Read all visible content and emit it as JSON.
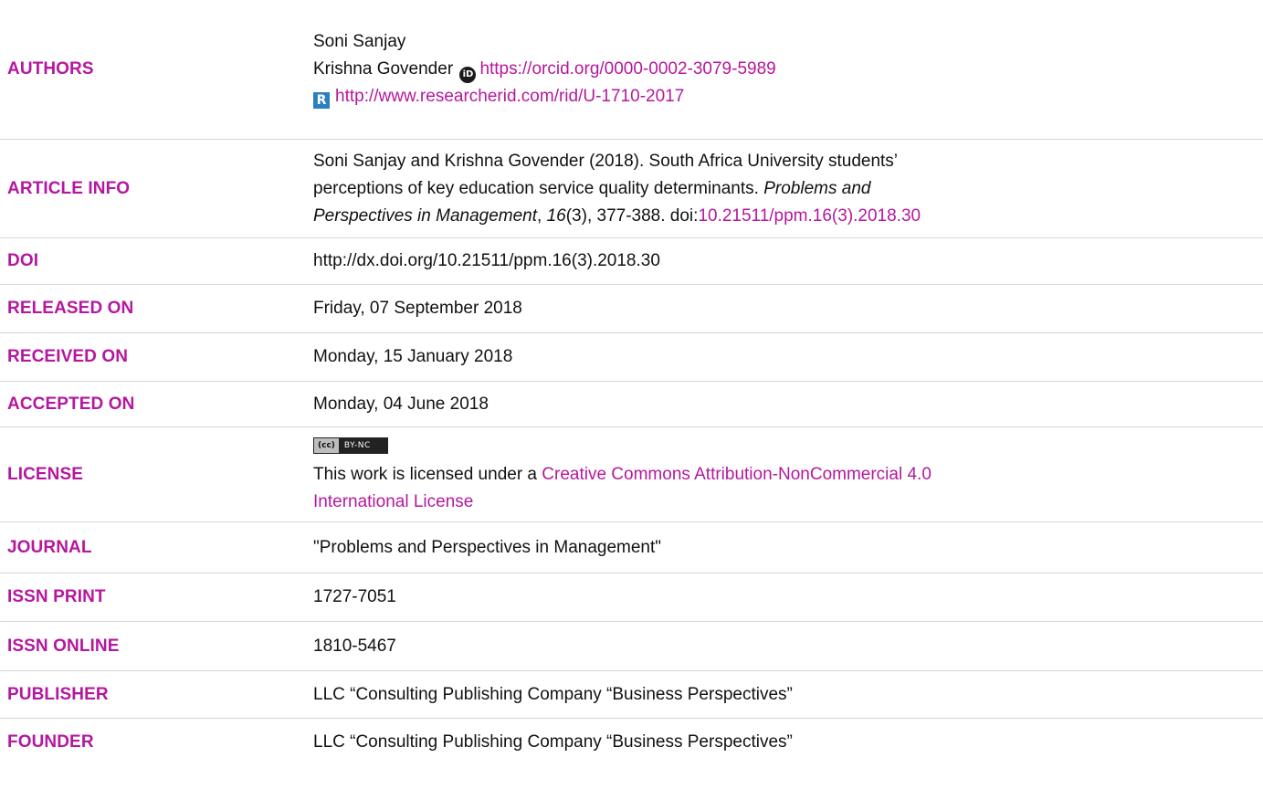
{
  "rows": {
    "authors": {
      "label": "AUTHORS",
      "author1": "Soni Sanjay",
      "author2": "Krishna Govender",
      "orcid_icon_text": "iD",
      "orcid_url": "https://orcid.org/0000-0002-3079-5989",
      "rid_icon_text": "R",
      "rid_url": "http://www.researcherid.com/rid/U-1710-2017"
    },
    "article_info": {
      "label": "ARTICLE INFO",
      "text1": "Soni Sanjay and Krishna Govender (2018). South Africa University students’",
      "text2": "perceptions of key education service quality determinants. ",
      "journal_italic_a": "Problems and",
      "journal_italic_b": "Perspectives in Management",
      "comma": ", ",
      "volume_italic": "16",
      "issue_pages": "(3), 377-388",
      "doi_prefix": ". doi:",
      "doi_link": "10.21511/ppm.16(3).2018.30"
    },
    "doi": {
      "label": "DOI",
      "value": "http://dx.doi.org/10.21511/ppm.16(3).2018.30"
    },
    "released_on": {
      "label": "RELEASED ON",
      "value": "Friday, 07 September 2018"
    },
    "received_on": {
      "label": "RECEIVED ON",
      "value": "Monday, 15 January 2018"
    },
    "accepted_on": {
      "label": "ACCEPTED ON",
      "value": "Monday, 04 June 2018"
    },
    "license": {
      "label": "LICENSE",
      "badge_cc": "(cc)",
      "badge_text": "BY-NC",
      "text_prefix": "This work is licensed under a ",
      "link_line1": "Creative Commons Attribution-NonCommercial 4.0",
      "link_line2": "International License"
    },
    "journal": {
      "label": "JOURNAL",
      "value": "\"Problems and Perspectives in Management\""
    },
    "issn_print": {
      "label": "ISSN PRINT",
      "value": "1727-7051"
    },
    "issn_online": {
      "label": "ISSN ONLINE",
      "value": "1810-5467"
    },
    "publisher": {
      "label": "PUBLISHER",
      "value": "LLC “Consulting Publishing Company “Business Perspectives”"
    },
    "founder": {
      "label": "FOUNDER",
      "value": "LLC “Consulting Publishing Company “Business Perspectives”"
    }
  },
  "colors": {
    "label": "#b5179e",
    "link": "#b5179e",
    "text": "#111111",
    "divider": "#d6d6d6"
  }
}
